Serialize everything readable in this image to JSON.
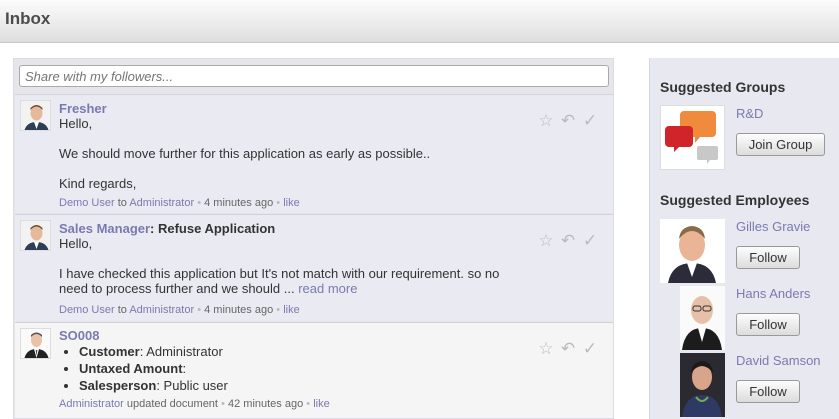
{
  "header": {
    "title": "Inbox"
  },
  "share": {
    "placeholder": "Share with my followers..."
  },
  "messages": [
    {
      "author": "Fresher",
      "lines": [
        "Hello,",
        "We should move further for this application as early as possible..",
        "Kind regards,"
      ],
      "meta": {
        "from": "Demo User",
        "to_word": "to",
        "to": "Administrator",
        "time": "4 minutes ago",
        "like": "like"
      }
    },
    {
      "author": "Sales Manager",
      "subject": ": Refuse Application",
      "lines": [
        "Hello,",
        "I have checked this application but It's not match with our requirement. so no",
        "need to process further and we should ..."
      ],
      "read_more": "read more",
      "meta": {
        "from": "Demo User",
        "to_word": "to",
        "to": "Administrator",
        "time": "4 minutes ago",
        "like": "like"
      }
    },
    {
      "author": "SO008",
      "bullets": [
        {
          "label": "Customer",
          "value": ": Administrator"
        },
        {
          "label": "Untaxed Amount",
          "value": ":"
        },
        {
          "label": "Salesperson",
          "value": ": Public user"
        }
      ],
      "meta": {
        "from": "Administrator",
        "action": "updated document",
        "time": "42 minutes ago",
        "like": "like"
      }
    }
  ],
  "sidebar": {
    "groups_title": "Suggested Groups",
    "group": {
      "name": "R&D",
      "button": "Join Group"
    },
    "employees_title": "Suggested Employees",
    "employees": [
      {
        "name": "Gilles Gravie",
        "button": "Follow"
      },
      {
        "name": "Hans Anders",
        "button": "Follow"
      },
      {
        "name": "David Samson",
        "button": "Follow"
      }
    ]
  },
  "icons": [
    "star-icon",
    "reply-icon",
    "check-icon",
    "sep-dot"
  ],
  "colors": {
    "link": "#7a7ab0",
    "feed_bg": "#e5e5ea",
    "message_bg": "#eaeaf3"
  }
}
